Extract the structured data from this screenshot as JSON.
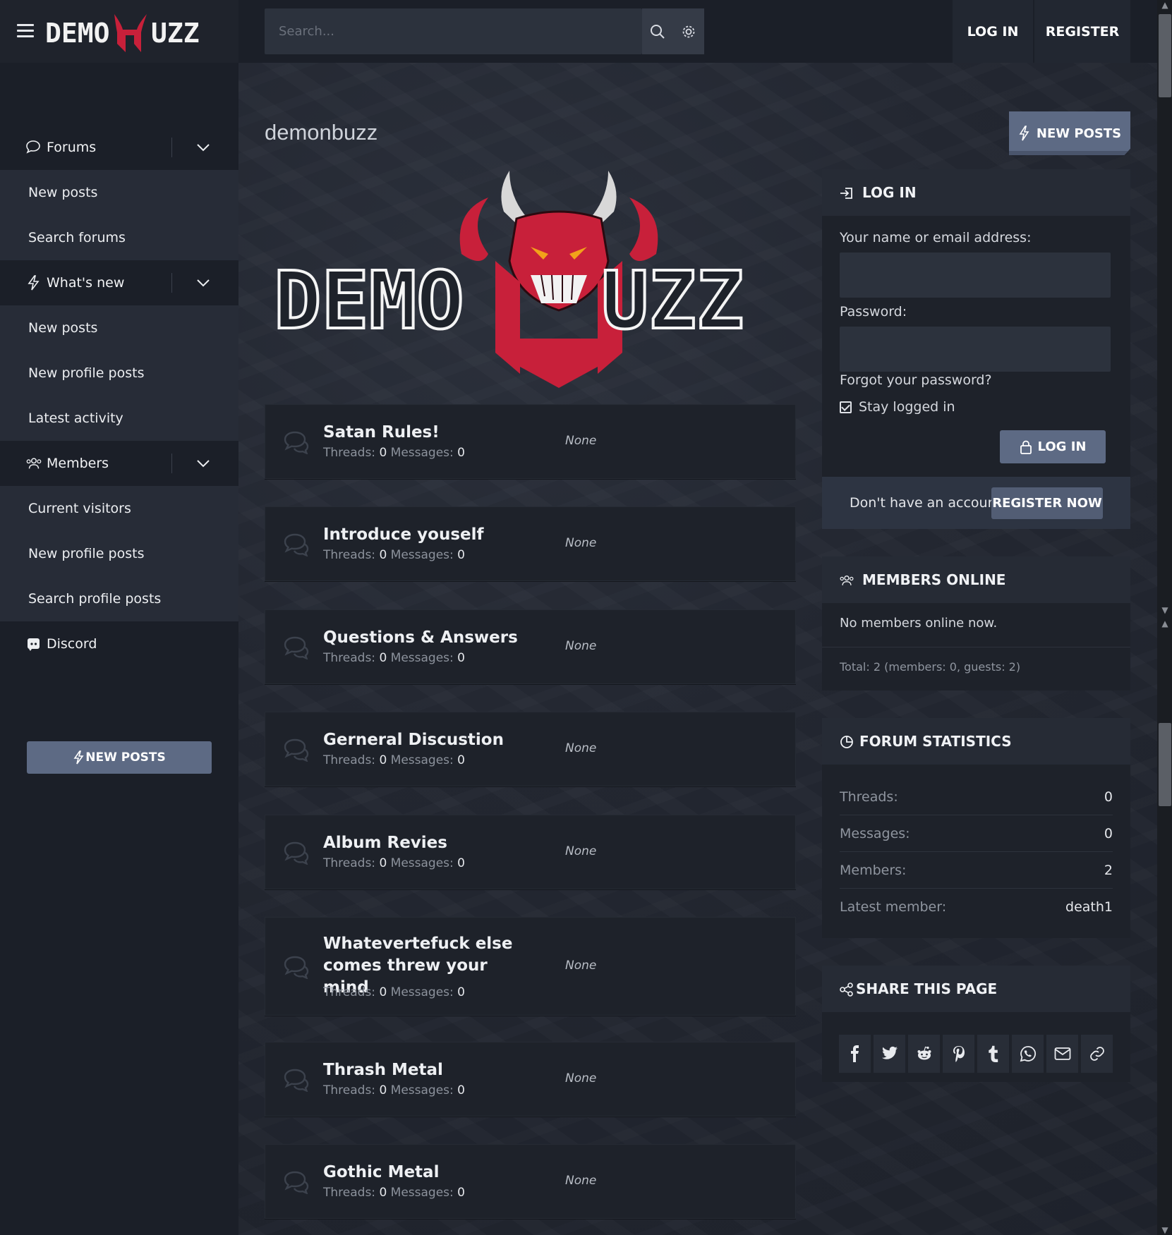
{
  "header": {
    "brand_name": "DEMONBUZZ",
    "search_placeholder": "Search...",
    "login_label": "LOG IN",
    "register_label": "REGISTER",
    "icons": [
      "menu-icon",
      "search-icon",
      "gear-icon"
    ]
  },
  "sidebar": {
    "sections": [
      {
        "label": "Forums",
        "icon": "comments-icon",
        "items": [
          "New posts",
          "Search forums"
        ]
      },
      {
        "label": "What's new",
        "icon": "bolt-icon",
        "items": [
          "New posts",
          "New profile posts",
          "Latest activity"
        ]
      },
      {
        "label": "Members",
        "icon": "users-icon",
        "items": [
          "Current visitors",
          "New profile posts",
          "Search profile posts"
        ]
      }
    ],
    "discord_label": "Discord",
    "new_posts_button": "NEW POSTS"
  },
  "main": {
    "title": "demonbuzz",
    "new_posts_button": "NEW POSTS",
    "forums": [
      {
        "title": "Satan Rules!",
        "threads": "0",
        "messages": "0",
        "last": "None"
      },
      {
        "title": "Introduce youself",
        "threads": "0",
        "messages": "0",
        "last": "None"
      },
      {
        "title": "Questions & Answers",
        "threads": "0",
        "messages": "0",
        "last": "None"
      },
      {
        "title": "Gerneral Discustion",
        "threads": "0",
        "messages": "0",
        "last": "None"
      },
      {
        "title": "Album Revies",
        "threads": "0",
        "messages": "0",
        "last": "None"
      },
      {
        "title": "Whatevertefuck else comes threw your mind",
        "threads": "0",
        "messages": "0",
        "last": "None"
      },
      {
        "title": "Thrash Metal",
        "threads": "0",
        "messages": "0",
        "last": "None"
      },
      {
        "title": "Gothic Metal",
        "threads": "0",
        "messages": "0",
        "last": "None"
      }
    ],
    "threads_label": "Threads:",
    "messages_label": "Messages:"
  },
  "login_block": {
    "title": "LOG IN",
    "name_label": "Your name or email address:",
    "password_label": "Password:",
    "forgot_label": "Forgot your password?",
    "stay_logged_label": "Stay logged in",
    "stay_logged_checked": true,
    "submit_label": "LOG IN",
    "no_account_label": "Don't have an account?",
    "register_now_label": "REGISTER NOW"
  },
  "members_online": {
    "title": "MEMBERS ONLINE",
    "status": "No members online now.",
    "total": "Total: 2 (members: 0, guests: 2)"
  },
  "forum_statistics": {
    "title": "FORUM STATISTICS",
    "rows": [
      {
        "label": "Threads:",
        "value": "0"
      },
      {
        "label": "Messages:",
        "value": "0"
      },
      {
        "label": "Members:",
        "value": "2"
      },
      {
        "label": "Latest member:",
        "value": "death1"
      }
    ]
  },
  "share": {
    "title": "SHARE THIS PAGE",
    "icons": [
      "facebook-icon",
      "twitter-icon",
      "reddit-icon",
      "pinterest-icon",
      "tumblr-icon",
      "whatsapp-icon",
      "email-icon",
      "link-icon"
    ]
  },
  "colors": {
    "background": "#1c2029",
    "panel": "#1e222a",
    "accent_button": "#5d6a84",
    "brand_red": "#c8203a"
  }
}
